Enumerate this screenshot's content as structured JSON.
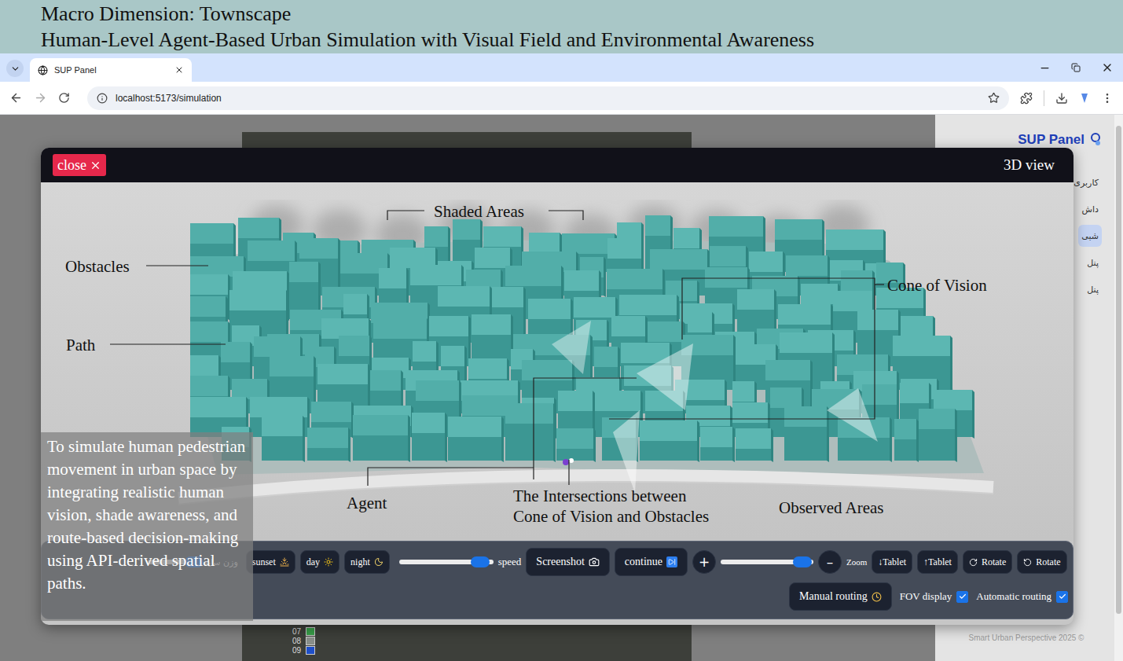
{
  "header": {
    "lines": [
      "Macro Dimension: Townscape",
      "Human-Level Agent-Based Urban Simulation with Visual Field and Environmental Awareness"
    ]
  },
  "browser": {
    "tabs": [
      {
        "label": "SUP Panel",
        "selected": true
      }
    ],
    "url": "localhost:5173/simulation"
  },
  "page": {
    "sidebar": {
      "title": "SUP Panel",
      "items": [
        {
          "label": "کاربری",
          "selected": false
        },
        {
          "label": "داش",
          "selected": false
        },
        {
          "label": "شبی",
          "selected": true
        },
        {
          "label": "پنل",
          "selected": false
        },
        {
          "label": "پنل",
          "selected": false
        }
      ],
      "footer": "Smart Urban Perspective 2025 ©"
    },
    "legend": [
      {
        "label": "07",
        "color": "#3aa04a"
      },
      {
        "label": "08",
        "color": "#8a8f8a"
      },
      {
        "label": "09",
        "color": "#1f4fc8"
      }
    ]
  },
  "modal": {
    "close": "close",
    "title": "3D view",
    "annotations": [
      {
        "lines": [
          "Shaded Areas"
        ]
      },
      {
        "lines": [
          "Obstacles"
        ]
      },
      {
        "lines": [
          "Path"
        ]
      },
      {
        "lines": [
          "Cone of Vision"
        ]
      },
      {
        "lines": [
          "Agent"
        ]
      },
      {
        "lines": [
          "The Intersections between",
          "Cone of Vision and Obstacles"
        ]
      },
      {
        "lines": [
          "Observed Areas"
        ]
      }
    ],
    "caption": "To simulate human pedestrian movement in urban space by integrating realistic human vision, shade awareness, and route-based decision-making using API-derived spatial paths.",
    "controls": {
      "shade_weight": {
        "label": "وزن سایه",
        "level": 0.9
      },
      "modes": [
        {
          "label": "sunset"
        },
        {
          "label": "day"
        },
        {
          "label": "night"
        }
      ],
      "speed": {
        "label": "speed",
        "level": 0.86
      },
      "screenshot": "Screenshot",
      "continue": "continue",
      "zoom": {
        "in": "+",
        "out": "–",
        "label": "Zoom",
        "level": 0.88
      },
      "tablet": [
        "↓Tablet",
        "↑Tablet"
      ],
      "rotate": [
        "Rotate",
        "Rotate"
      ],
      "manual_routing": "Manual routing",
      "toggles": [
        {
          "label": "FOV display",
          "checked": true
        },
        {
          "label": "Automatic routing",
          "checked": true
        }
      ]
    }
  }
}
